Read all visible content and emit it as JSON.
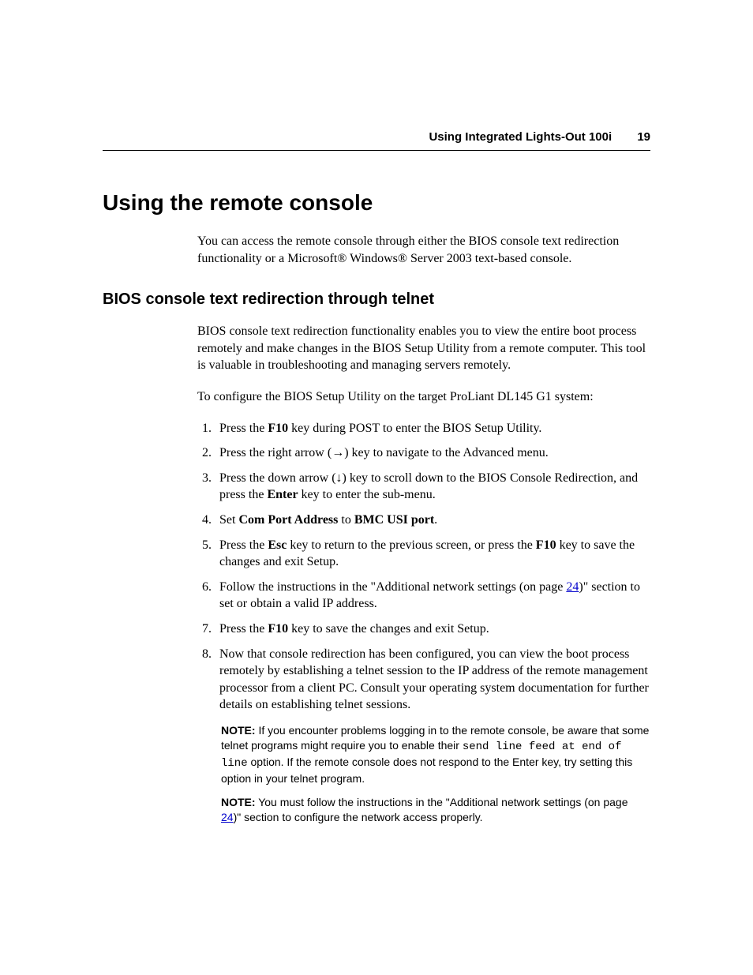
{
  "header": {
    "title": "Using Integrated Lights-Out 100i",
    "page_number": "19"
  },
  "h1": "Using the remote console",
  "intro": "You can access the remote console through either the BIOS console text redirection functionality or a Microsoft® Windows® Server 2003 text-based console.",
  "h2": "BIOS console text redirection through telnet",
  "p2": "BIOS console text redirection functionality enables you to view the entire boot process remotely and make changes in the BIOS Setup Utility from a remote computer. This tool is valuable in troubleshooting and managing servers remotely.",
  "p3": "To configure the BIOS Setup Utility on the target ProLiant DL145 G1 system:",
  "steps": {
    "s1_a": "Press the ",
    "s1_b": "F10",
    "s1_c": " key during POST to enter the BIOS Setup Utility.",
    "s2": "Press the right arrow (→) key to navigate to the Advanced menu.",
    "s3_a": "Press the down arrow (↓) key to scroll down to the BIOS Console Redirection, and press the ",
    "s3_b": "Enter",
    "s3_c": " key to enter the sub-menu.",
    "s4_a": "Set ",
    "s4_b": "Com Port Address",
    "s4_c": " to ",
    "s4_d": "BMC USI port",
    "s4_e": ".",
    "s5_a": "Press the ",
    "s5_b": "Esc",
    "s5_c": " key to return to the previous screen, or press the ",
    "s5_d": "F10",
    "s5_e": " key to save the changes and exit Setup.",
    "s6_a": "Follow the instructions in the \"Additional network settings (on page ",
    "s6_link": "24",
    "s6_b": ")\" section to set or obtain a valid IP address.",
    "s7_a": "Press the ",
    "s7_b": "F10",
    "s7_c": " key to save the changes and exit Setup.",
    "s8": "Now that console redirection has been configured, you can view the boot process remotely by establishing a telnet session to the IP address of the remote management processor from a client PC. Consult your operating system documentation for further details on establishing telnet sessions."
  },
  "note1": {
    "label": "NOTE:",
    "a": "  If you encounter problems logging in to the remote console, be aware that some telnet programs might require you to enable their ",
    "mono": "send line feed at end of line",
    "b": " option. If the remote console does not respond to the Enter key, try setting this option in your telnet program."
  },
  "note2": {
    "label": "NOTE:",
    "a": "  You must follow the instructions in the \"Additional network settings (on page ",
    "link": "24",
    "b": ")\" section to configure the network access properly."
  }
}
